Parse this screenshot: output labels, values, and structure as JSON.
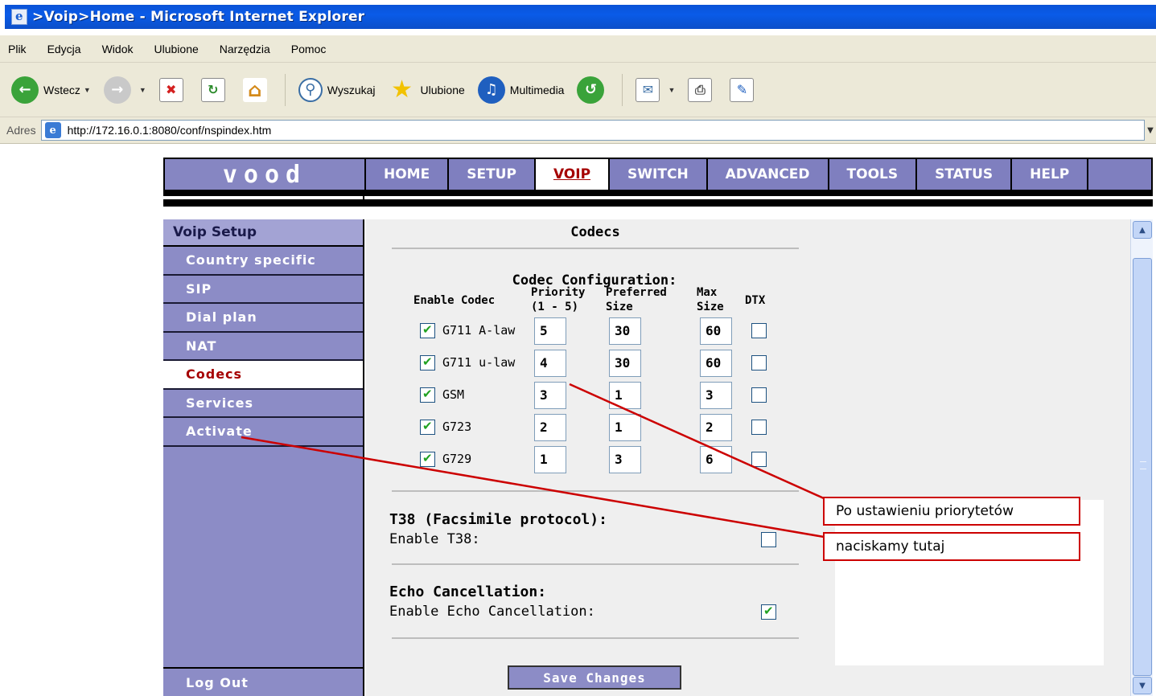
{
  "browser": {
    "title": ">Voip>Home - Microsoft Internet Explorer",
    "menu": [
      "Plik",
      "Edycja",
      "Widok",
      "Ulubione",
      "Narzędzia",
      "Pomoc"
    ],
    "toolbar": {
      "back": "Wstecz",
      "search": "Wyszukaj",
      "favorites": "Ulubione",
      "media": "Multimedia"
    },
    "address_label": "Adres",
    "url": "http://172.16.0.1:8080/conf/nspindex.htm"
  },
  "nav": {
    "logo": "vood",
    "tabs": [
      "HOME",
      "SETUP",
      "VOIP",
      "SWITCH",
      "ADVANCED",
      "TOOLS",
      "STATUS",
      "HELP"
    ],
    "active": "VOIP"
  },
  "sidebar": {
    "title": "Voip Setup",
    "items": [
      "Country specific",
      "SIP",
      "Dial plan",
      "NAT",
      "Codecs",
      "Services",
      "Activate"
    ],
    "active": "Codecs",
    "logout": "Log Out"
  },
  "codecs": {
    "page_title": "Codecs",
    "config_title": "Codec Configuration:",
    "headers": {
      "enable": "Enable Codec",
      "priority_1": "Priority",
      "priority_2": "(1 - 5)",
      "preferred_1": "Preferred",
      "preferred_2": "Size",
      "max_1": "Max",
      "max_2": "Size",
      "dtx": "DTX"
    },
    "rows": [
      {
        "name": "G711 A-law",
        "enabled": true,
        "priority": "5",
        "preferred": "30",
        "max": "60",
        "dtx": false
      },
      {
        "name": "G711 u-law",
        "enabled": true,
        "priority": "4",
        "preferred": "30",
        "max": "60",
        "dtx": false
      },
      {
        "name": "GSM",
        "enabled": true,
        "priority": "3",
        "preferred": "1",
        "max": "3",
        "dtx": false
      },
      {
        "name": "G723",
        "enabled": true,
        "priority": "2",
        "preferred": "1",
        "max": "2",
        "dtx": false
      },
      {
        "name": "G729",
        "enabled": true,
        "priority": "1",
        "preferred": "3",
        "max": "6",
        "dtx": false
      }
    ],
    "t38_title": "T38 (Facsimile protocol):",
    "t38_label": "Enable T38:",
    "t38_enabled": false,
    "echo_title": "Echo Cancellation:",
    "echo_label": "Enable Echo Cancellation:",
    "echo_enabled": true,
    "save_button": "Save Changes"
  },
  "annotation": {
    "line1": "Po ustawieniu priorytetów",
    "line2": "naciskamy tutaj",
    "color": "#cc0000"
  }
}
